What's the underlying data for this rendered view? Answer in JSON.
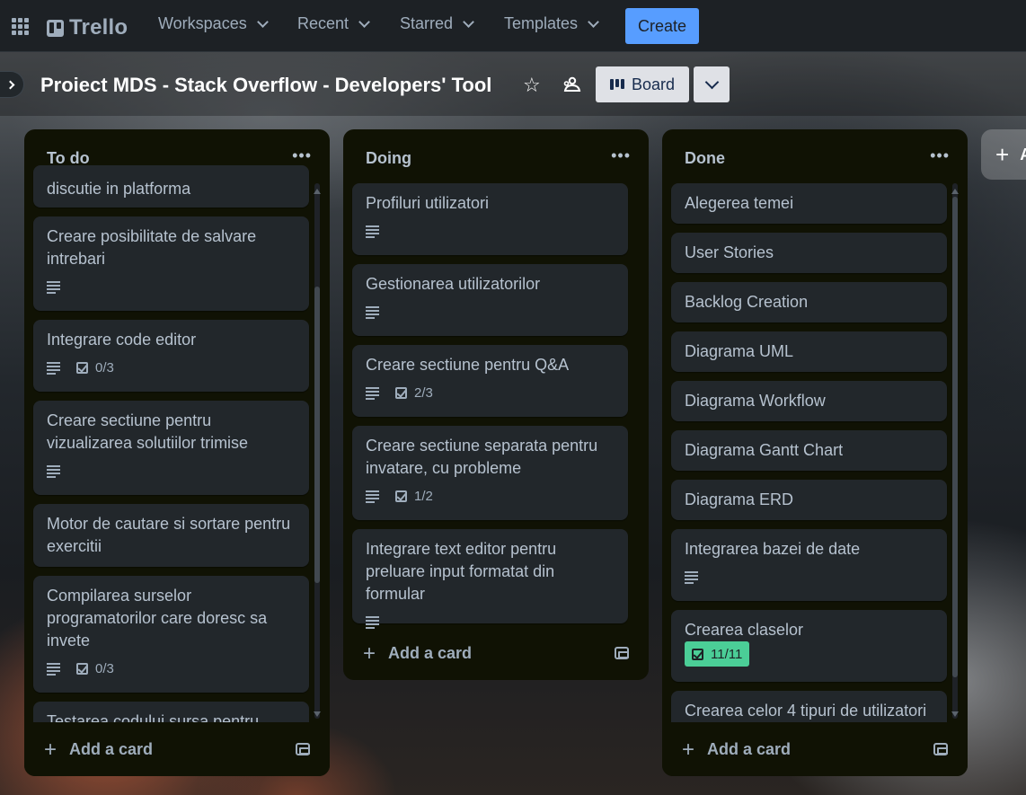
{
  "topbar": {
    "logo": "Trello",
    "nav": [
      {
        "label": "Workspaces"
      },
      {
        "label": "Recent"
      },
      {
        "label": "Starred"
      },
      {
        "label": "Templates"
      }
    ],
    "create_label": "Create"
  },
  "board": {
    "title": "Proiect MDS - Stack Overflow - Developers' Tool",
    "view_label": "Board"
  },
  "lists": [
    {
      "title": "To do",
      "add_card_label": "Add a card",
      "cards": [
        {
          "title": "discutie in platforma"
        },
        {
          "title": "Creare posibilitate de salvare intrebari",
          "description": true
        },
        {
          "title": "Integrare code editor",
          "description": true,
          "checklist": "0/3"
        },
        {
          "title": "Creare sectiune pentru vizualizarea solutiilor trimise",
          "description": true
        },
        {
          "title": "Motor de cautare si sortare pentru exercitii"
        },
        {
          "title": "Compilarea surselor programatorilor care doresc sa invete",
          "description": true,
          "checklist": "0/3"
        },
        {
          "title": "Testarea codului sursa pentru"
        }
      ]
    },
    {
      "title": "Doing",
      "add_card_label": "Add a card",
      "cards": [
        {
          "title": "Profiluri utilizatori",
          "description": true
        },
        {
          "title": "Gestionarea utilizatorilor",
          "description": true
        },
        {
          "title": "Creare sectiune pentru Q&A",
          "description": true,
          "checklist": "2/3"
        },
        {
          "title": "Creare sectiune separata pentru invatare, cu probleme",
          "description": true,
          "checklist": "1/2"
        },
        {
          "title": "Integrare text editor pentru preluare input formatat din formular",
          "description": true
        }
      ]
    },
    {
      "title": "Done",
      "add_card_label": "Add a card",
      "cards": [
        {
          "title": "Alegerea temei"
        },
        {
          "title": "User Stories"
        },
        {
          "title": "Backlog Creation"
        },
        {
          "title": "Diagrama UML"
        },
        {
          "title": "Diagrama Workflow"
        },
        {
          "title": "Diagrama Gantt Chart"
        },
        {
          "title": "Diagrama ERD"
        },
        {
          "title": "Integrarea bazei de date",
          "description": true
        },
        {
          "title": "Crearea claselor",
          "checklist": "11/11",
          "checklist_complete": true
        },
        {
          "title": "Crearea celor 4 tipuri de utilizatori"
        }
      ]
    }
  ],
  "add_list_label": "A",
  "colors": {
    "accent": "#579dff",
    "list_bg": "#101204",
    "card_bg": "#22272b",
    "checklist_complete": "#4bce97"
  }
}
